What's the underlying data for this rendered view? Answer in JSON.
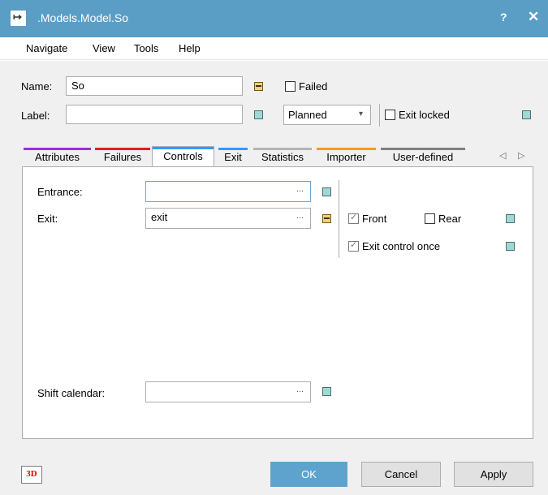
{
  "window": {
    "title": ".Models.Model.So",
    "help_label": "?",
    "close_label": "✕",
    "app_icon_glyph": "↦"
  },
  "menu": [
    "Navigate",
    "View",
    "Tools",
    "Help"
  ],
  "header": {
    "name_label": "Name:",
    "name_value": "So",
    "label_label": "Label:",
    "label_value": "",
    "failed_label": "Failed",
    "status_value": "Planned",
    "exit_locked_label": "Exit locked"
  },
  "tabs": [
    {
      "label": "Attributes",
      "color": "#9b30d9"
    },
    {
      "label": "Failures",
      "color": "#e02020"
    },
    {
      "label": "Controls",
      "color": "#3399ff"
    },
    {
      "label": "Exit",
      "color": "#3399ff"
    },
    {
      "label": "Statistics",
      "color": "#b4b4b4"
    },
    {
      "label": "Importer",
      "color": "#f39a1e"
    },
    {
      "label": "User-defined",
      "color": "#808080"
    }
  ],
  "tab_scroll": {
    "left": "◁",
    "right": "▷"
  },
  "controls": {
    "entrance_label": "Entrance:",
    "entrance_value": "",
    "exit_label": "Exit:",
    "exit_value": "exit",
    "shift_calendar_label": "Shift calendar:",
    "shift_calendar_value": "",
    "ellipsis": "...",
    "front_label": "Front",
    "front_checked": true,
    "rear_label": "Rear",
    "rear_checked": false,
    "exit_control_once_label": "Exit control once",
    "exit_control_once_checked": true
  },
  "footer": {
    "three_d_label": "3D",
    "ok_label": "OK",
    "cancel_label": "Cancel",
    "apply_label": "Apply"
  }
}
